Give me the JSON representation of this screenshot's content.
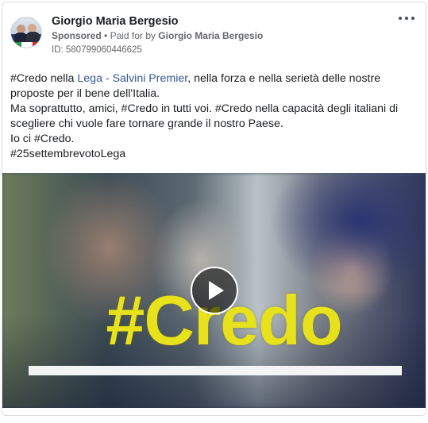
{
  "advertiser": {
    "name": "Giorgio Maria Bergesio",
    "sponsored_label": "Sponsored",
    "separator": "•",
    "paid_for_prefix": "Paid for by",
    "paid_for_name": "Giorgio Maria Bergesio",
    "ad_id": "ID: 580799060446625"
  },
  "post": {
    "line1_pre": "#Credo nella ",
    "line1_link": "Lega - Salvini Premier",
    "line1_post": ", nella forza e nella serietà delle nostre proposte per il bene dell'Italia.",
    "line2": "Ma soprattutto, amici, #Credo in tutti voi. #Credo nella capacità degli italiani di scegliere chi vuole fare tornare grande il nostro Paese.",
    "line3": "Io ci #Credo.",
    "line4": "#25settembrevotoLega"
  },
  "video": {
    "overlay_text": "#Credo"
  },
  "colors": {
    "link": "#385898",
    "overlay_text": "#e7e21c",
    "muted": "#65676b"
  },
  "icons": {
    "more": "more-options-icon",
    "play": "play-icon"
  }
}
